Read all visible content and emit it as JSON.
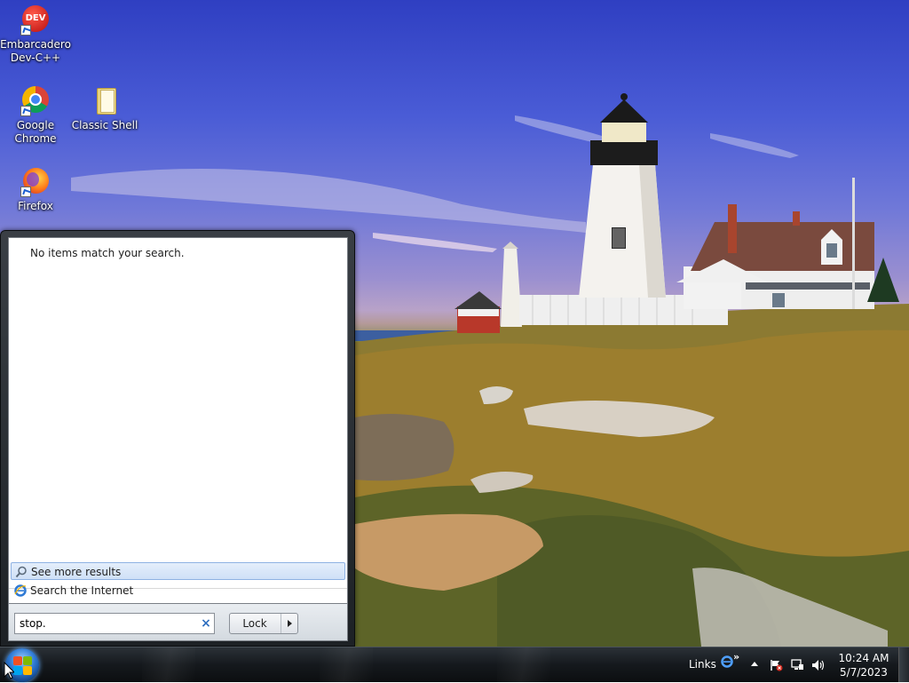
{
  "desktop": {
    "icons": [
      {
        "label_line1": "Embarcadero",
        "label_line2": "Dev-C++",
        "icon": "devcpp-icon",
        "badge": "DEV"
      },
      {
        "label_line1": "Google",
        "label_line2": "Chrome",
        "icon": "chrome-icon"
      },
      {
        "label_line1": "Classic Shell",
        "label_line2": "",
        "icon": "folder-icon"
      },
      {
        "label_line1": "Firefox",
        "label_line2": "",
        "icon": "firefox-icon"
      }
    ]
  },
  "start_menu": {
    "no_results_text": "No items match your search.",
    "see_more_results": "See more results",
    "search_internet": "Search the Internet",
    "search_value": "stop.",
    "clear_symbol": "×",
    "lock_label": "Lock"
  },
  "taskbar": {
    "links_label": "Links",
    "links_chevron": "»",
    "clock_time": "10:24 AM",
    "clock_date": "5/7/2023"
  },
  "colors": {
    "selection_bg": "#cfe0f7",
    "taskbar_bg": "#15191d",
    "accent_blue": "#2f6fc0"
  }
}
